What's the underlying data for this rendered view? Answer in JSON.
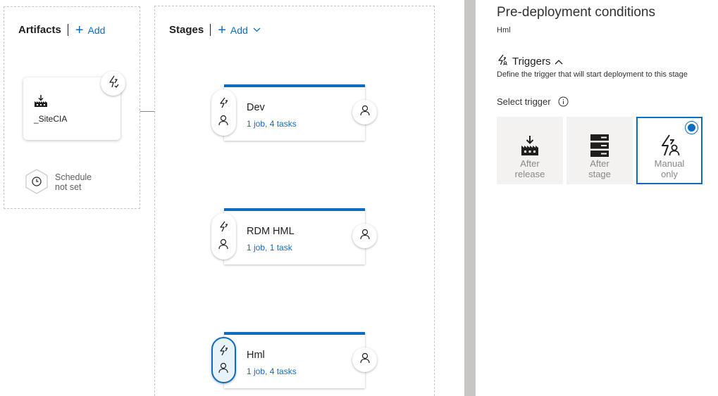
{
  "artifacts": {
    "title": "Artifacts",
    "add_label": "Add",
    "artifact_name": "_SiteCIA",
    "schedule_text": "Schedule not set",
    "schedule_line1": "Schedule",
    "schedule_line2": "not set"
  },
  "stages": {
    "title": "Stages",
    "add_label": "Add",
    "items": [
      {
        "name": "Dev",
        "summary": "1 job, 4 tasks",
        "selected": false
      },
      {
        "name": "RDM HML",
        "summary": "1 job, 1 task",
        "selected": false
      },
      {
        "name": "Hml",
        "summary": "1 job, 4 tasks",
        "selected": true
      }
    ]
  },
  "panel": {
    "title": "Pre-deployment conditions",
    "subtitle": "Hml",
    "triggers_label": "Triggers",
    "triggers_description": "Define the trigger that will start deployment to this stage",
    "select_trigger_label": "Select trigger",
    "options": [
      {
        "line1": "After",
        "line2": "release",
        "icon": "release-icon",
        "selected": false
      },
      {
        "line1": "After",
        "line2": "stage",
        "icon": "stage-icon",
        "selected": false
      },
      {
        "line1": "Manual",
        "line2": "only",
        "icon": "manual-only-icon",
        "selected": true
      }
    ]
  },
  "colors": {
    "accent": "#0f6cbd",
    "card_border": "#c8c6c4",
    "option_bg": "#f3f2f1",
    "muted_text": "#8a8886"
  },
  "icons": {
    "artifact": "build-artifact-icon",
    "trigger": "lightning-icon",
    "approver": "person-icon",
    "schedule": "clock-icon",
    "info": "info-icon",
    "chevron_up": "chevron-up-icon",
    "chevron_down": "chevron-down-icon"
  }
}
